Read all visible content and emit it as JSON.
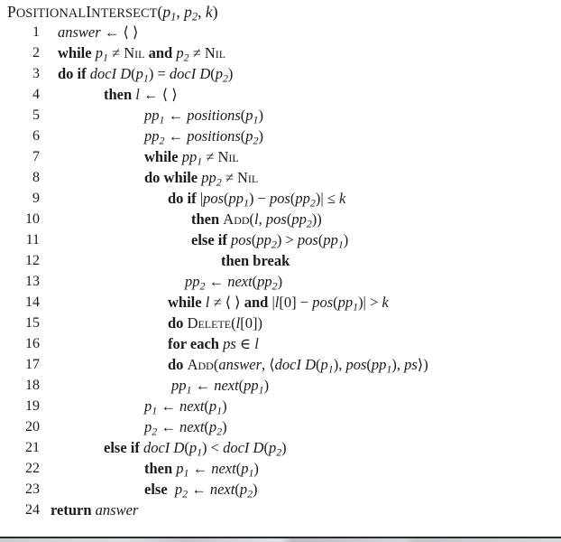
{
  "figure": {
    "title_name": "PositionalIntersect",
    "title_args": "(p1, p2, k)",
    "bottom_rule": true
  },
  "lines": [
    {
      "num": "1",
      "indent": "ind-1",
      "text": "answer ← ⟨ ⟩"
    },
    {
      "num": "2",
      "indent": "ind-1",
      "text": "while p1 ≠ NIL and p2 ≠ NIL"
    },
    {
      "num": "3",
      "indent": "ind-1",
      "text": "do if docID(p1) = docID(p2)"
    },
    {
      "num": "4",
      "indent": "ind-2",
      "text": "then l ← ⟨ ⟩"
    },
    {
      "num": "5",
      "indent": "ind-3",
      "text": "pp1 ← positions(p1)"
    },
    {
      "num": "6",
      "indent": "ind-3",
      "text": "pp2 ← positions(p2)"
    },
    {
      "num": "7",
      "indent": "ind-3",
      "text": "while pp1 ≠ NIL"
    },
    {
      "num": "8",
      "indent": "ind-3",
      "text": "do while pp2 ≠ NIL"
    },
    {
      "num": "9",
      "indent": "ind-4",
      "text": "do if |pos(pp1) − pos(pp2)| ≤ k"
    },
    {
      "num": "10",
      "indent": "ind-6",
      "text": "then ADD(l, pos(pp2))"
    },
    {
      "num": "11",
      "indent": "ind-6",
      "text": "else if pos(pp2) > pos(pp1)"
    },
    {
      "num": "12",
      "indent": "ind-8",
      "text": "then break"
    },
    {
      "num": "13",
      "indent": "ind-5",
      "text": "pp2 ← next(pp2)"
    },
    {
      "num": "14",
      "indent": "ind-4",
      "text": "while l ≠ ⟨ ⟩ and |l[0] − pos(pp1)| > k"
    },
    {
      "num": "15",
      "indent": "ind-4",
      "text": "do DELETE(l[0])"
    },
    {
      "num": "16",
      "indent": "ind-4",
      "text": "for each ps ∈ l"
    },
    {
      "num": "17",
      "indent": "ind-4",
      "text": "do ADD(answer, ⟨docID(p1), pos(pp1), ps⟩)"
    },
    {
      "num": "18",
      "indent": "ind-7",
      "text": "pp1 ← next(pp1)"
    },
    {
      "num": "19",
      "indent": "ind-3",
      "text": "p1 ← next(p1)"
    },
    {
      "num": "20",
      "indent": "ind-3",
      "text": "p2 ← next(p2)"
    },
    {
      "num": "21",
      "indent": "ind-2",
      "text": "else if docID(p1) < docID(p2)"
    },
    {
      "num": "22",
      "indent": "ind-3",
      "text": "then p1 ← next(p1)"
    },
    {
      "num": "23",
      "indent": "ind-3",
      "text": "else p2 ← next(p2)"
    },
    {
      "num": "24",
      "indent": "ind-0",
      "text": "return answer"
    }
  ],
  "colors": {
    "text": "#1a1a1a",
    "background": "#ffffff",
    "rule": "#2b2b2b"
  }
}
